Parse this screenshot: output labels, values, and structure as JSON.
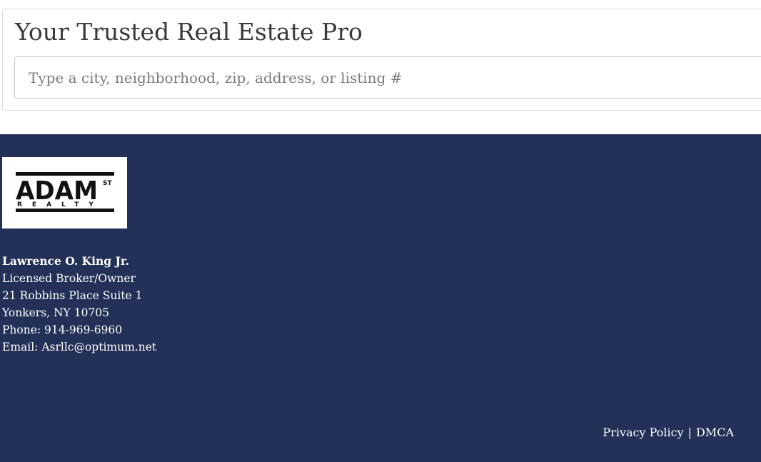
{
  "search": {
    "title": "Your Trusted Real Estate Pro",
    "placeholder": "Type a city, neighborhood, zip, address, or listing #",
    "value": ""
  },
  "logo": {
    "main_text": "ADAM",
    "superscript": "ST",
    "sub_text": "REALTY"
  },
  "contact": {
    "name": "Lawrence O. King Jr.",
    "title": "Licensed Broker/Owner",
    "address_line1": "21 Robbins Place Suite 1",
    "address_line2": "Yonkers, NY 10705",
    "phone": "Phone: 914-969-6960",
    "email": "Email: Asrllc@optimum.net"
  },
  "legal": {
    "privacy_label": "Privacy Policy",
    "separator": "|",
    "dmca_label": "DMCA"
  },
  "colors": {
    "footer_bg": "#233057",
    "text_on_dark": "#ffffff",
    "title_text": "#3a3a3a"
  }
}
